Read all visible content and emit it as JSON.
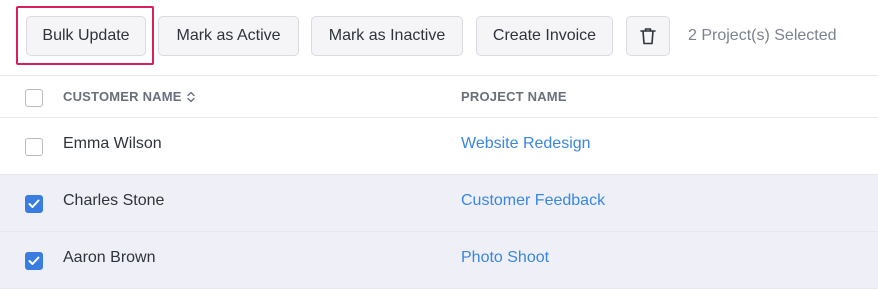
{
  "toolbar": {
    "bulk_update_label": "Bulk Update",
    "mark_active_label": "Mark as Active",
    "mark_inactive_label": "Mark as Inactive",
    "create_invoice_label": "Create Invoice",
    "delete_icon": "trash-icon",
    "selected_text": "2 Project(s) Selected"
  },
  "table": {
    "headers": {
      "customer_name": "CUSTOMER NAME",
      "project_name": "PROJECT NAME",
      "sort_icon": "sort-icon"
    },
    "rows": [
      {
        "customer": "Emma Wilson",
        "project": "Website Redesign",
        "checked": false
      },
      {
        "customer": "Charles Stone",
        "project": "Customer Feedback",
        "checked": true
      },
      {
        "customer": "Aaron Brown",
        "project": "Photo Shoot",
        "checked": true
      }
    ]
  },
  "colors": {
    "accent": "#3a7de0",
    "link": "#3a86e0",
    "focus_outline": "#d81e5b",
    "selected_row_bg": "#eff0f7"
  }
}
